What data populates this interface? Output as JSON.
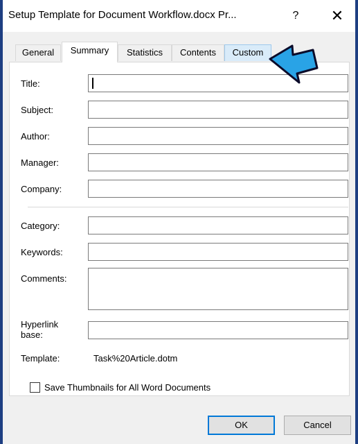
{
  "window": {
    "title": "Setup Template for Document Workflow.docx Pr...",
    "help_label": "?",
    "close_label": "✕"
  },
  "tabs": [
    {
      "label": "General"
    },
    {
      "label": "Summary",
      "active": true
    },
    {
      "label": "Statistics"
    },
    {
      "label": "Contents"
    },
    {
      "label": "Custom",
      "hover": true
    }
  ],
  "fields": {
    "title": {
      "label": "Title:",
      "value": ""
    },
    "subject": {
      "label": "Subject:",
      "value": ""
    },
    "author": {
      "label": "Author:",
      "value": ""
    },
    "manager": {
      "label": "Manager:",
      "value": ""
    },
    "company": {
      "label": "Company:",
      "value": ""
    },
    "category": {
      "label": "Category:",
      "value": ""
    },
    "keywords": {
      "label": "Keywords:",
      "value": ""
    },
    "comments": {
      "label": "Comments:",
      "value": ""
    },
    "hyperlink_base": {
      "label_line1": "Hyperlink",
      "label_line2": "base:",
      "value": ""
    }
  },
  "template": {
    "label": "Template:",
    "value": "Task%20Article.dotm"
  },
  "thumbnail_checkbox": {
    "label": "Save Thumbnails for All Word Documents",
    "checked": false
  },
  "buttons": {
    "ok": "OK",
    "cancel": "Cancel"
  },
  "colors": {
    "accent": "#0078d7",
    "arrow": "#29a3e6",
    "frame": "#1e3f82"
  },
  "icons": {
    "pointer": "arrow-pointer-icon"
  }
}
